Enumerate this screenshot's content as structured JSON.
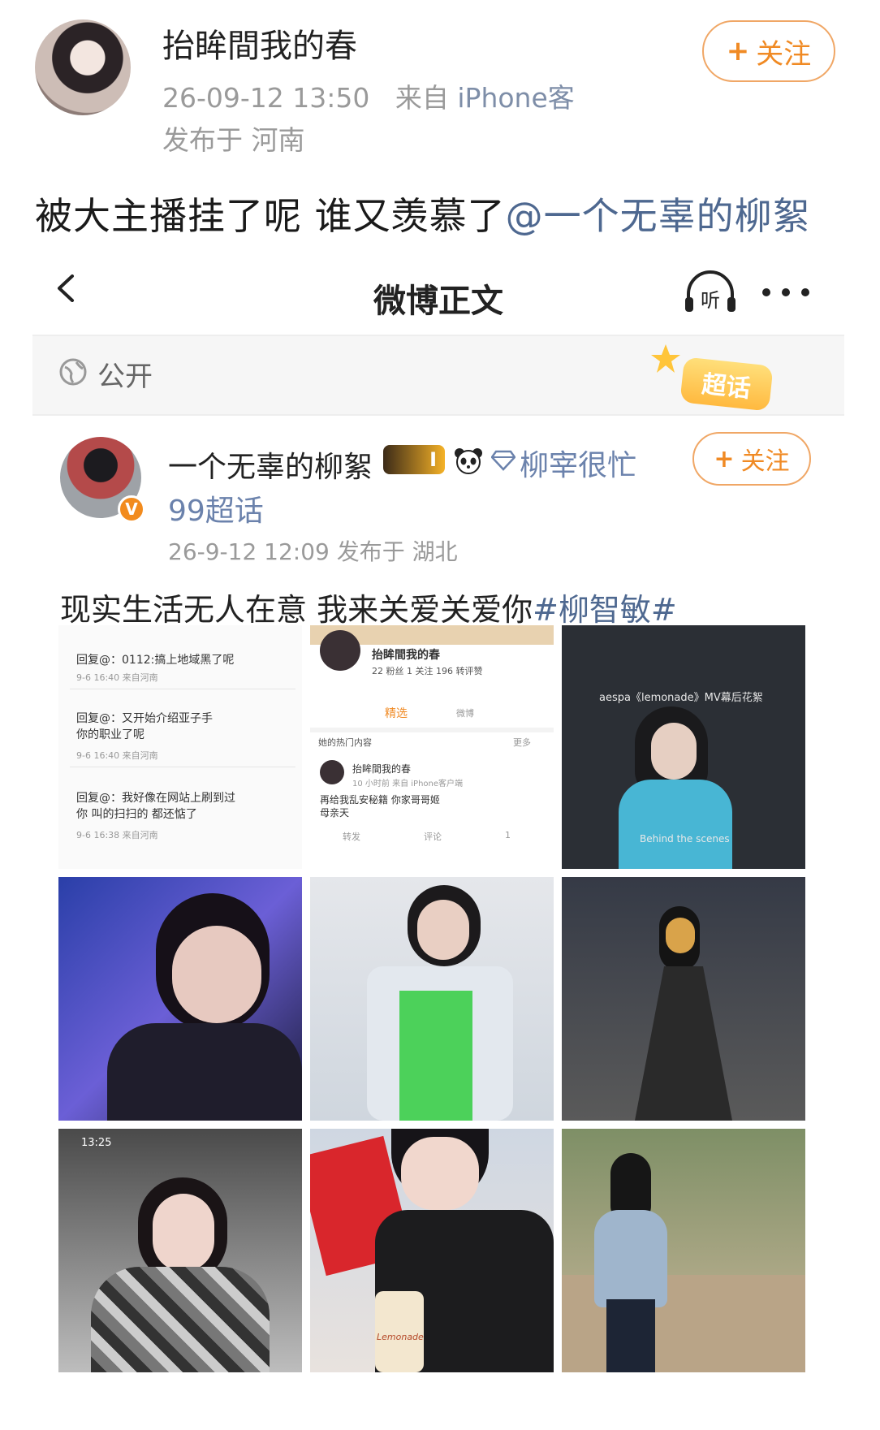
{
  "outer_post": {
    "author": "抬眸間我的春",
    "timestamp": "26-09-12 13:50",
    "source_prefix": "来自",
    "source_device": "iPhone客",
    "location": "发布于 河南",
    "follow_label": "关注",
    "text": "被大主播挂了呢 谁又羡慕了",
    "mention": "@一个无辜的柳絮"
  },
  "screenshot": {
    "nav": {
      "title": "微博正文",
      "listen_label": "听"
    },
    "visibility": "公开",
    "supertopic_badge": "超话",
    "author": {
      "name": "一个无辜的柳絮",
      "level_badge": "I",
      "fan_name": "柳宰很忙",
      "topic_count": "99超话",
      "meta": "26-9-12 12:09  发布于 湖北",
      "follow_label": "关注"
    },
    "text": "现实生活无人在意 我来关爱关爱你",
    "hashtag": "#柳智敏#",
    "images": {
      "comments": [
        {
          "reply": "回复@：0112:搞上地域黑了呢",
          "meta": "9-6 16:40 来自河南"
        },
        {
          "reply": "回复@：又开始介绍亚子手",
          "reply2": "你的职业了呢",
          "meta": "9-6 16:40 来自河南"
        },
        {
          "reply": "回复@：我好像在网站上刷到过",
          "reply2": "你 叫的扫扫的 都还惦了",
          "meta": "9-6 16:38 来自河南"
        }
      ],
      "profile": {
        "name": "抬眸間我的春",
        "stats": "22 粉丝   1 关注   196 转评赞",
        "tab1": "精选",
        "tab2": "微博",
        "hot": "她的热门内容",
        "more": "更多",
        "post_name": "抬眸間我的春",
        "post_meta": "10 小时前 来自 iPhone客户端",
        "post_text": "再给我乱安秘籍 你家哥哥姬",
        "post_text2": "母亲天",
        "repost": "转发",
        "comment": "评论",
        "like": "1"
      },
      "mv_caption": "aespa《lemonade》MV幕后花絮",
      "mv_sub": "Behind the scenes",
      "phone_time": "13:25",
      "bottle_label": "Lemonade"
    }
  }
}
